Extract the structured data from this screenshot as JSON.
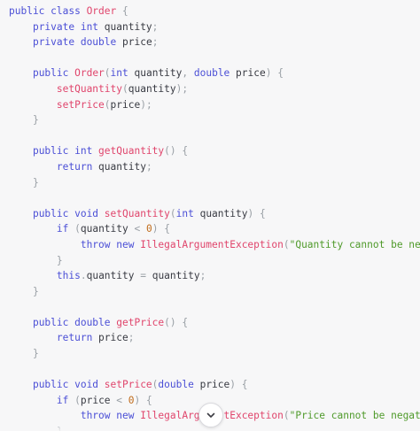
{
  "code_block": {
    "language": "java",
    "lines": [
      [
        [
          "kw",
          "public class "
        ],
        [
          "nm",
          "Order"
        ],
        [
          "pl",
          " "
        ],
        [
          "pu",
          "{"
        ]
      ],
      [
        [
          "pl",
          "    "
        ],
        [
          "kw",
          "private int "
        ],
        [
          "pl",
          "quantity"
        ],
        [
          "pu",
          ";"
        ]
      ],
      [
        [
          "pl",
          "    "
        ],
        [
          "kw",
          "private double "
        ],
        [
          "pl",
          "price"
        ],
        [
          "pu",
          ";"
        ]
      ],
      [],
      [
        [
          "pl",
          "    "
        ],
        [
          "kw",
          "public "
        ],
        [
          "nm",
          "Order"
        ],
        [
          "pu",
          "("
        ],
        [
          "kw",
          "int "
        ],
        [
          "pl",
          "quantity"
        ],
        [
          "pu",
          ", "
        ],
        [
          "kw",
          "double "
        ],
        [
          "pl",
          "price"
        ],
        [
          "pu",
          ") {"
        ]
      ],
      [
        [
          "pl",
          "        "
        ],
        [
          "nm",
          "setQuantity"
        ],
        [
          "pu",
          "("
        ],
        [
          "pl",
          "quantity"
        ],
        [
          "pu",
          ");"
        ]
      ],
      [
        [
          "pl",
          "        "
        ],
        [
          "nm",
          "setPrice"
        ],
        [
          "pu",
          "("
        ],
        [
          "pl",
          "price"
        ],
        [
          "pu",
          ");"
        ]
      ],
      [
        [
          "pl",
          "    "
        ],
        [
          "pu",
          "}"
        ]
      ],
      [],
      [
        [
          "pl",
          "    "
        ],
        [
          "kw",
          "public int "
        ],
        [
          "nm",
          "getQuantity"
        ],
        [
          "pu",
          "() {"
        ]
      ],
      [
        [
          "pl",
          "        "
        ],
        [
          "kw",
          "return "
        ],
        [
          "pl",
          "quantity"
        ],
        [
          "pu",
          ";"
        ]
      ],
      [
        [
          "pl",
          "    "
        ],
        [
          "pu",
          "}"
        ]
      ],
      [],
      [
        [
          "pl",
          "    "
        ],
        [
          "kw",
          "public void "
        ],
        [
          "nm",
          "setQuantity"
        ],
        [
          "pu",
          "("
        ],
        [
          "kw",
          "int "
        ],
        [
          "pl",
          "quantity"
        ],
        [
          "pu",
          ") {"
        ]
      ],
      [
        [
          "pl",
          "        "
        ],
        [
          "kw",
          "if "
        ],
        [
          "pu",
          "("
        ],
        [
          "pl",
          "quantity "
        ],
        [
          "pu",
          "< "
        ],
        [
          "nu",
          "0"
        ],
        [
          "pu",
          ") {"
        ]
      ],
      [
        [
          "pl",
          "            "
        ],
        [
          "kw",
          "throw new "
        ],
        [
          "nm",
          "IllegalArgumentException"
        ],
        [
          "pu",
          "("
        ],
        [
          "st",
          "\"Quantity cannot be nega"
        ]
      ],
      [
        [
          "pl",
          "        "
        ],
        [
          "pu",
          "}"
        ]
      ],
      [
        [
          "pl",
          "        "
        ],
        [
          "kw",
          "this"
        ],
        [
          "pu",
          "."
        ],
        [
          "pl",
          "quantity "
        ],
        [
          "pu",
          "= "
        ],
        [
          "pl",
          "quantity"
        ],
        [
          "pu",
          ";"
        ]
      ],
      [
        [
          "pl",
          "    "
        ],
        [
          "pu",
          "}"
        ]
      ],
      [],
      [
        [
          "pl",
          "    "
        ],
        [
          "kw",
          "public double "
        ],
        [
          "nm",
          "getPrice"
        ],
        [
          "pu",
          "() {"
        ]
      ],
      [
        [
          "pl",
          "        "
        ],
        [
          "kw",
          "return "
        ],
        [
          "pl",
          "price"
        ],
        [
          "pu",
          ";"
        ]
      ],
      [
        [
          "pl",
          "    "
        ],
        [
          "pu",
          "}"
        ]
      ],
      [],
      [
        [
          "pl",
          "    "
        ],
        [
          "kw",
          "public void "
        ],
        [
          "nm",
          "setPrice"
        ],
        [
          "pu",
          "("
        ],
        [
          "kw",
          "double "
        ],
        [
          "pl",
          "price"
        ],
        [
          "pu",
          ") {"
        ]
      ],
      [
        [
          "pl",
          "        "
        ],
        [
          "kw",
          "if "
        ],
        [
          "pu",
          "("
        ],
        [
          "pl",
          "price "
        ],
        [
          "pu",
          "< "
        ],
        [
          "nu",
          "0"
        ],
        [
          "pu",
          ") {"
        ]
      ],
      [
        [
          "pl",
          "            "
        ],
        [
          "kw",
          "throw new "
        ],
        [
          "nm",
          "IllegalArgumentException"
        ],
        [
          "pu",
          "("
        ],
        [
          "st",
          "\"Price cannot be negativ"
        ]
      ],
      [
        [
          "pl",
          "        "
        ],
        [
          "pu",
          "}"
        ]
      ]
    ]
  },
  "scroll_button": {
    "icon": "chevron-down-icon"
  }
}
